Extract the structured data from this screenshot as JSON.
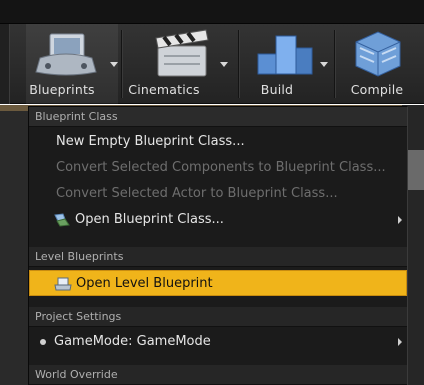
{
  "toolbar": {
    "buttons": [
      {
        "label": "Blueprints",
        "icon": "blueprints-icon",
        "active": true
      },
      {
        "label": "Cinematics",
        "icon": "cinematics-icon"
      },
      {
        "label": "Build",
        "icon": "build-icon"
      },
      {
        "label": "Compile",
        "icon": "compile-icon"
      }
    ]
  },
  "menu": {
    "sections": {
      "blueprint_class": "Blueprint Class",
      "level_blueprints": "Level Blueprints",
      "project_settings": "Project Settings",
      "world_override": "World Override"
    },
    "items": {
      "new_empty": "New Empty Blueprint Class...",
      "convert_components": "Convert Selected Components to Blueprint Class...",
      "convert_actor": "Convert Selected Actor to Blueprint Class...",
      "open_class": "Open Blueprint Class...",
      "open_level": "Open Level Blueprint",
      "gamemode": "GameMode: GameMode"
    },
    "highlight_color": "#f0b41a"
  }
}
